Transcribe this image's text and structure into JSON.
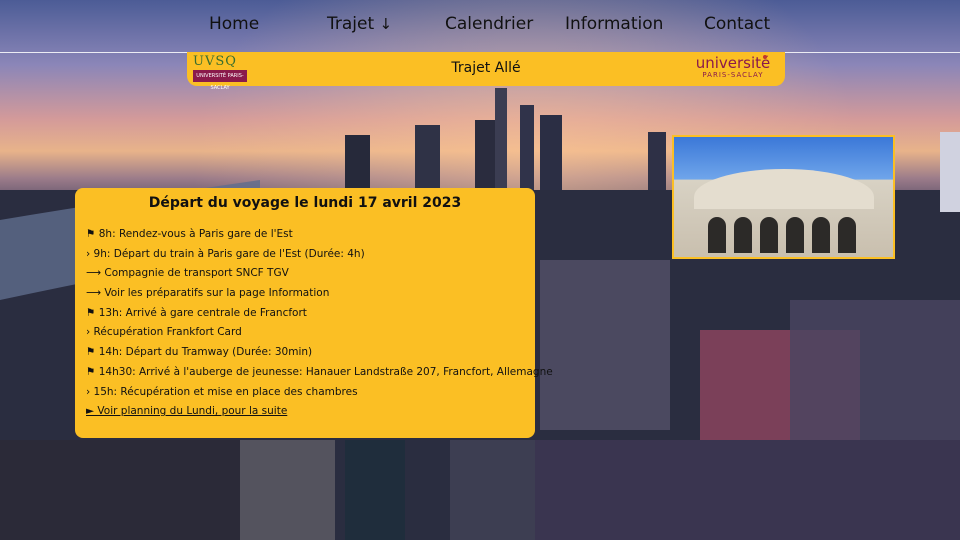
{
  "nav": {
    "items": [
      {
        "label": "Home"
      },
      {
        "label": "Trajet",
        "icon": "arrow-down-icon",
        "glyph": "↓"
      },
      {
        "label": "Calendrier"
      },
      {
        "label": "Information"
      },
      {
        "label": "Contact"
      }
    ]
  },
  "banner": {
    "title": "Trajet Allé",
    "left_logo": {
      "text": "UVSQ",
      "sub": "UNIVERSITÉ PARIS-SACLAY"
    },
    "right_logo": {
      "main": "université",
      "sub": "PARIS-SACLAY"
    }
  },
  "card": {
    "title": "Départ du voyage le lundi 17 avril 2023",
    "items": [
      "⚑ 8h: Rendez-vous à Paris gare de l'Est",
      "› 9h: Départ du train à Paris gare de l'Est (Durée: 4h)",
      "⟶ Compagnie de transport SNCF TGV",
      "⟶ Voir les préparatifs sur la page Information",
      "⚑ 13h: Arrivé à gare centrale de Francfort",
      "› Récupération Frankfort Card",
      "⚑ 14h: Départ du Tramway (Durée: 30min)",
      "⚑ 14h30: Arrivé à l'auberge de jeunesse: Hanauer Landstraße 207, Francfort, Allemagne",
      "› 15h: Récupération et mise en place des chambres"
    ],
    "link": "► Voir planning du Lundi, pour la suite"
  },
  "colors": {
    "accent": "#fbbf24",
    "brand": "#8a1a4b"
  }
}
